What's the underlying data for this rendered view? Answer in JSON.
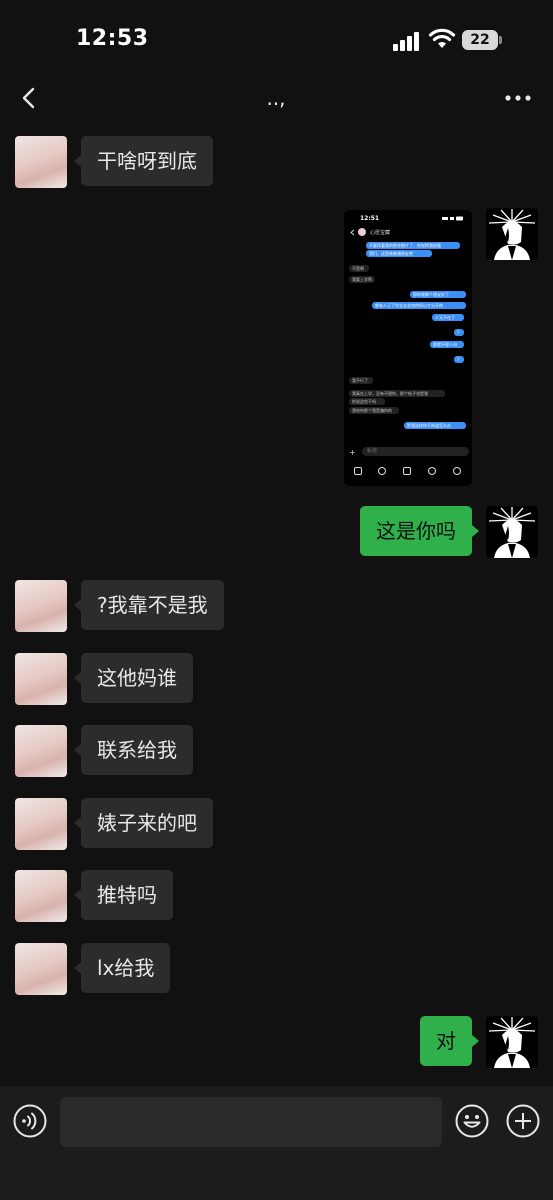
{
  "status_bar": {
    "time": "12:53",
    "battery": "22"
  },
  "nav": {
    "title": "..,"
  },
  "messages": [
    {
      "side": "in",
      "text": "干啥呀到底"
    },
    {
      "side": "out",
      "type": "image",
      "caption": ""
    },
    {
      "side": "out",
      "text": "这是你吗"
    },
    {
      "side": "in",
      "text": "?我靠不是我"
    },
    {
      "side": "in",
      "text": "这他妈谁"
    },
    {
      "side": "in",
      "text": "联系给我"
    },
    {
      "side": "in",
      "text": "婊子来的吧"
    },
    {
      "side": "in",
      "text": "推特吗"
    },
    {
      "side": "in",
      "text": "lx给我"
    },
    {
      "side": "out",
      "text": "对"
    }
  ],
  "embedded_screenshot": {
    "time": "12:51",
    "title": "心愿宝藏",
    "lines": [
      {
        "side": "out",
        "text": "不要再看我的那些照片了，你觉得我很骚"
      },
      {
        "side": "out",
        "text": "我们，还是做普通朋友吧"
      },
      {
        "side": "in",
        "text": "不是啊"
      },
      {
        "side": "in",
        "text": "我要上学啊"
      },
      {
        "side": "out",
        "text": "那你就做个朋友好了"
      },
      {
        "side": "out",
        "text": "哪有人订了毕业去北京的所以才分开的"
      },
      {
        "side": "out",
        "text": "人又不在了"
      },
      {
        "side": "out",
        "text": "?"
      },
      {
        "side": "out",
        "text": "那就不理人吗"
      },
      {
        "side": "out",
        "text": "?"
      },
      {
        "side": "in",
        "text": "我不行了"
      },
      {
        "side": "in",
        "text": "我真在上学，没有不理你，那个帖子也是我"
      },
      {
        "side": "in",
        "text": "你说这些干吗"
      },
      {
        "side": "in",
        "text": "我给你那个我是骗你的"
      },
      {
        "side": "out",
        "text": "那我这样你不知道怎么办"
      }
    ],
    "input_placeholder": "私信"
  },
  "colors": {
    "background": "#111111",
    "bubble_in": "#2c2c2c",
    "bubble_out": "#2fb04a",
    "input_bar": "#1c1c1c"
  },
  "input": {
    "value": "",
    "placeholder": ""
  },
  "icons": [
    "back-icon",
    "more-icon",
    "voice-icon",
    "emoji-icon",
    "plus-icon"
  ]
}
